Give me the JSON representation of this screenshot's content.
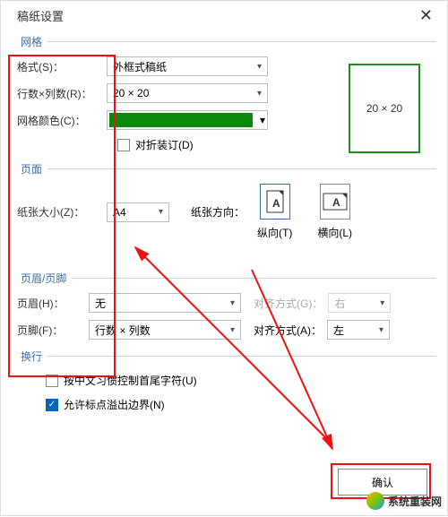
{
  "title": "稿纸设置",
  "sections": {
    "grid": "网格",
    "page": "页面",
    "hf": "页眉/页脚",
    "wrap": "换行"
  },
  "labels": {
    "format": "格式(S)：",
    "rowcol": "行数×列数(R)：",
    "gridcolor": "网格颜色(C)：",
    "fold": "对折装订(D)",
    "papersize": "纸张大小(Z)：",
    "orient": "纸张方向：",
    "portrait": "纵向(T)",
    "landscape": "横向(L)",
    "header": "页眉(H)：",
    "footer": "页脚(F)：",
    "align_g": "对齐方式(G)：",
    "align_a": "对齐方式(A)：",
    "cjk": "按中文习惯控制首尾字符(U)",
    "overflow": "允许标点溢出边界(N)"
  },
  "values": {
    "format": "外框式稿纸",
    "rowcol": "20 × 20",
    "papersize": "A4",
    "header": "无",
    "footer": "行数 × 列数",
    "align_g": "右",
    "align_a": "左",
    "preview": "20 × 20"
  },
  "colors": {
    "gridcolor": "#0a8a0a"
  },
  "buttons": {
    "ok": "确认"
  },
  "watermark": "系统重装网"
}
